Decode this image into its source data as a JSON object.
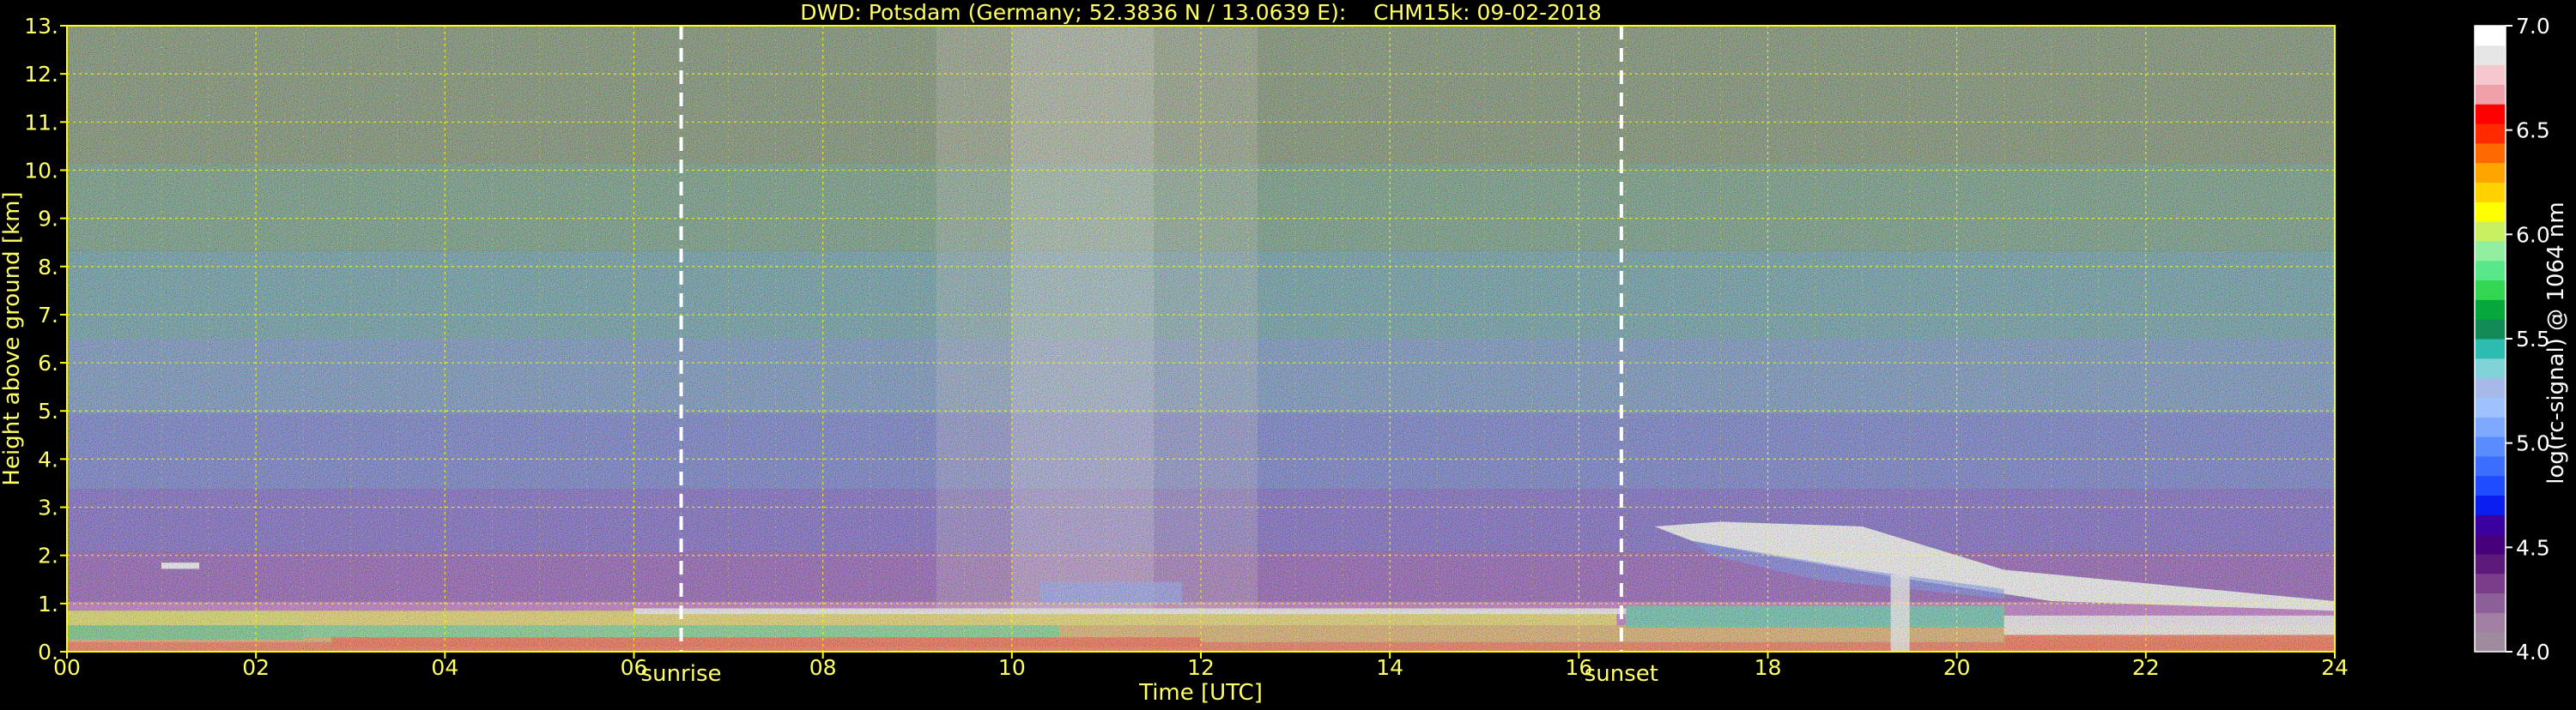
{
  "chart_data": {
    "type": "heatmap",
    "title": "DWD: Potsdam (Germany; 52.3836 N / 13.0639 E):    CHM15k: 09-02-2018",
    "xlabel": "Time [UTC]",
    "ylabel": "Height above ground [km]",
    "xlim": [
      0,
      24
    ],
    "ylim": [
      0,
      13
    ],
    "x_ticks": [
      0,
      2,
      4,
      6,
      8,
      10,
      12,
      14,
      16,
      18,
      20,
      22,
      24
    ],
    "x_tick_labels": [
      "00",
      "02",
      "04",
      "06",
      "08",
      "10",
      "12",
      "14",
      "16",
      "18",
      "20",
      "22",
      "24"
    ],
    "y_ticks": [
      0,
      1,
      2,
      3,
      4,
      5,
      6,
      7,
      8,
      9,
      10,
      11,
      12,
      13
    ],
    "y_tick_labels": [
      "0.",
      "1.",
      "2.",
      "3.",
      "4.",
      "5.",
      "6.",
      "7.",
      "8.",
      "9.",
      "10.",
      "11.",
      "12.",
      "13."
    ],
    "grid": true,
    "events": [
      {
        "label": "sunrise",
        "time": 6.5
      },
      {
        "label": "sunset",
        "time": 16.45
      }
    ],
    "colorbar": {
      "label": "log(rc-signal) @ 1064 nm",
      "range": [
        4.0,
        7.0
      ],
      "ticks": [
        4.0,
        4.5,
        5.0,
        5.5,
        6.0,
        6.5,
        7.0
      ],
      "tick_labels": [
        "4.0",
        "4.5",
        "5.0",
        "5.5",
        "6.0",
        "6.5",
        "7.0"
      ],
      "colors": [
        "#9e8c9e",
        "#a17fa3",
        "#8c5f99",
        "#7a3d8a",
        "#5e1a7a",
        "#48007a",
        "#3a00a0",
        "#0a1ef0",
        "#1f4cff",
        "#3b6dff",
        "#5b8cff",
        "#7fa8ff",
        "#9fc2ff",
        "#a6b9e8",
        "#7fd3d6",
        "#2dbcb0",
        "#118a56",
        "#06a83b",
        "#32d650",
        "#58e88a",
        "#90f0a0",
        "#c8f060",
        "#ffff00",
        "#ffd200",
        "#ffa500",
        "#ff6a00",
        "#ff2a00",
        "#ff0000",
        "#f0a0a8",
        "#f4c8cc",
        "#e6e6e6",
        "#ffffff"
      ]
    }
  },
  "colors": {
    "text": "#ffff66",
    "grid": "#ffff00",
    "event_line": "#ffffff",
    "colorbar_text": "#ffffff"
  }
}
